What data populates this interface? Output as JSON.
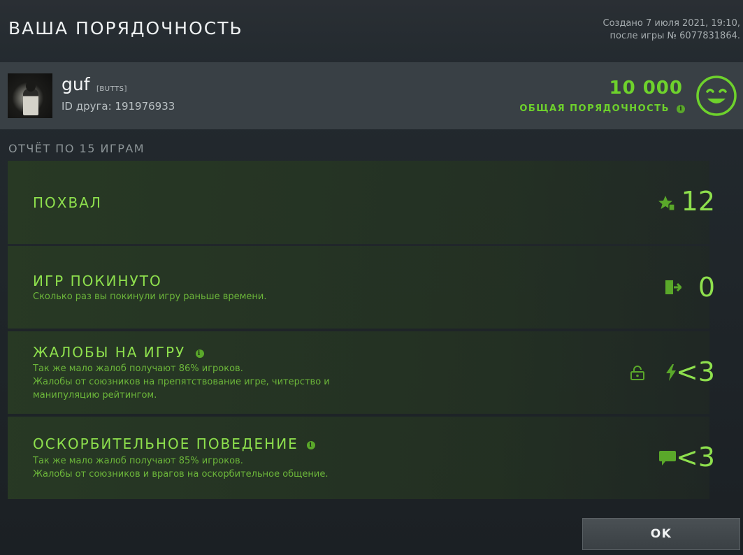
{
  "header": {
    "title": "ВАША ПОРЯДОЧНОСТЬ",
    "created_line1": "Создано 7 июля 2021, 19:10,",
    "created_line2": "после игры № 6077831864."
  },
  "profile": {
    "name": "guf",
    "tag": "[BUTTS]",
    "friend_id": "ID друга: 191976933",
    "score": "10 000",
    "score_label": "ОБЩАЯ ПОРЯДОЧНОСТЬ",
    "accent_color": "#6ed22c"
  },
  "report": {
    "title": "ОТЧЁТ ПО 15 ИГРАМ",
    "rows": [
      {
        "title": "ПОХВАЛ",
        "desc1": "",
        "desc2": "",
        "desc3": "",
        "value": "12",
        "icon": "star-thumb-icon"
      },
      {
        "title": "ИГР ПОКИНУТО",
        "desc1": "Сколько раз вы покинули игру раньше времени.",
        "desc2": "",
        "desc3": "",
        "value": "0",
        "icon": "exit-door-icon"
      },
      {
        "title": "ЖАЛОБЫ НА ИГРУ",
        "desc1": "Так же мало жалоб получают 86% игроков.",
        "desc2": "Жалобы от союзников на препятствование игре, читерство и",
        "desc3": "манипуляцию рейтингом.",
        "value": "<3",
        "icon": "lock-lightning-icon"
      },
      {
        "title": "ОСКОРБИТЕЛЬНОЕ ПОВЕДЕНИЕ",
        "desc1": "Так же мало жалоб получают 85% игроков.",
        "desc2": "Жалобы от союзников и врагов на оскорбительное общение.",
        "desc3": "",
        "value": "<3",
        "icon": "chat-bubble-icon"
      }
    ]
  },
  "ok_label": "OK"
}
